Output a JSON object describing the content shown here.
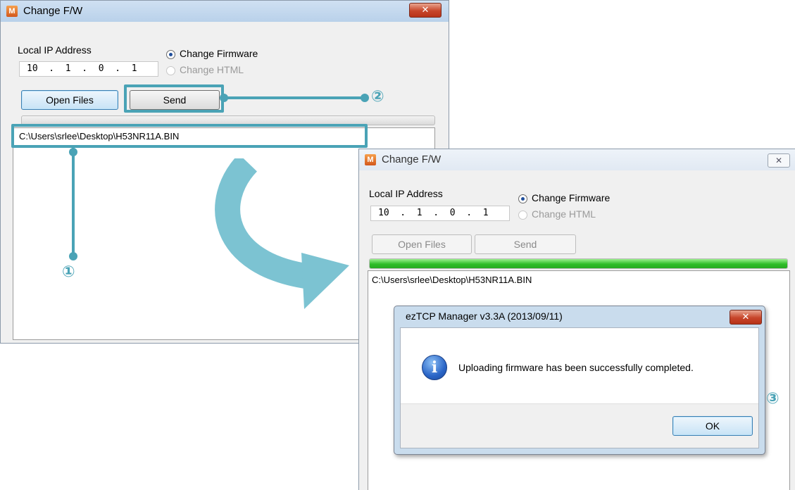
{
  "back_window": {
    "title": "Change F/W",
    "app_icon": "M",
    "close_glyph": "✕",
    "local_ip_label": "Local IP Address",
    "ip_value": "10  .  1  .  0  .  1",
    "radio_firmware": "Change Firmware",
    "radio_html": "Change HTML",
    "open_files": "Open Files",
    "send": "Send",
    "file_path": "C:\\Users\\srlee\\Desktop\\H53NR11A.BIN",
    "progress_fraction": 0
  },
  "front_window": {
    "title": "Change F/W",
    "app_icon": "M",
    "close_glyph": "✕",
    "local_ip_label": "Local IP Address",
    "ip_value": "10  .  1  .  0  .  1",
    "radio_firmware": "Change Firmware",
    "radio_html": "Change HTML",
    "open_files": "Open Files",
    "send": "Send",
    "file_path": "C:\\Users\\srlee\\Desktop\\H53NR11A.BIN",
    "progress_fraction": 1.0
  },
  "dialog": {
    "title": "ezTCP Manager v3.3A (2013/09/11)",
    "close_glyph": "✕",
    "icon": "info-icon",
    "icon_glyph": "i",
    "message": "Uploading firmware has been successfully completed.",
    "ok": "OK"
  },
  "callouts": {
    "step1": "①",
    "step2": "②",
    "step3": "③"
  },
  "colors": {
    "callout": "#4aa3b6",
    "progress": "#2fbd28",
    "close_button": "#c7452a"
  }
}
